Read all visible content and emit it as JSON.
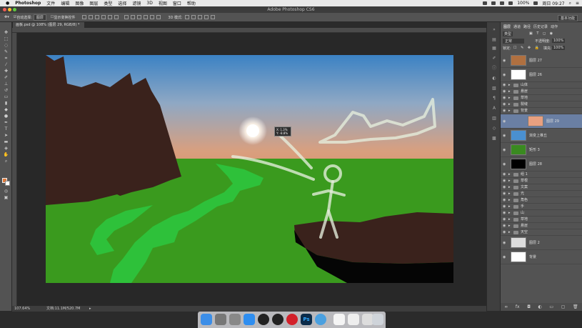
{
  "menubar": {
    "app_name": "Photoshop",
    "items": [
      "文件",
      "编辑",
      "图像",
      "图层",
      "类型",
      "选择",
      "滤镜",
      "3D",
      "视图",
      "窗口",
      "帮助"
    ],
    "battery": "100%",
    "clock": "周日 09:27"
  },
  "window": {
    "title": "Adobe Photoshop CS6"
  },
  "options": {
    "auto_select_label": "自动选择:",
    "auto_select_value": "图层",
    "show_transform_label": "显示变换控件",
    "mode_label": "3D 模式:",
    "workspace": "基本功能"
  },
  "document": {
    "tab_label": "画板.psd @ 108% (图层 29, RGB/8) *",
    "zoom": "107.64%",
    "doc_size": "文档:11.1M/520.7M"
  },
  "move_tip": {
    "x_line": "X: 1.3%",
    "y_line": "Y: -8.8%"
  },
  "layers_panel": {
    "tabs": [
      "图层",
      "通道",
      "路径",
      "历史记录",
      "动作"
    ],
    "kind_label": "类型",
    "blend_mode": "正常",
    "opacity_label": "不透明度:",
    "opacity_value": "100%",
    "lock_label": "锁定:",
    "fill_label": "填充:",
    "fill_value": "100%",
    "layers": [
      {
        "name": "图层 27",
        "type": "big",
        "thumb": "#b07040"
      },
      {
        "name": "图层 26",
        "type": "big",
        "thumb": "#ffffff"
      },
      {
        "name": "山体",
        "type": "folder"
      },
      {
        "name": "悬崖",
        "type": "folder"
      },
      {
        "name": "草地",
        "type": "folder"
      },
      {
        "name": "裂缝",
        "type": "folder"
      },
      {
        "name": "背景",
        "type": "folder"
      },
      {
        "name": "图层 29",
        "type": "big",
        "thumb": "#e8a080",
        "selected": true
      },
      {
        "name": "渐变上推丘",
        "type": "big",
        "thumb": "#4a90d0"
      },
      {
        "name": "矩形 3",
        "type": "big",
        "thumb": "#3a8a20"
      },
      {
        "name": "图层 28",
        "type": "big",
        "thumb": "#000000"
      },
      {
        "name": "组 1",
        "type": "folder"
      },
      {
        "name": "草根",
        "type": "folder"
      },
      {
        "name": "文案",
        "type": "folder"
      },
      {
        "name": "光",
        "type": "folder"
      },
      {
        "name": "角色",
        "type": "folder"
      },
      {
        "name": "手",
        "type": "folder"
      },
      {
        "name": "山",
        "type": "folder"
      },
      {
        "name": "草地",
        "type": "folder"
      },
      {
        "name": "悬崖",
        "type": "folder"
      },
      {
        "name": "天空",
        "type": "folder"
      },
      {
        "name": "图层 2",
        "type": "big",
        "thumb": "#dcdcdc"
      },
      {
        "name": "背景",
        "type": "big",
        "thumb": "#ffffff"
      }
    ]
  },
  "colors": {
    "sky_top": "#3b82c4",
    "sky_glow": "#d99f7e",
    "grass": "#3a9a1e",
    "stream": "#2ec13a",
    "mountain": "#3a221c",
    "foreground_swatch": "#e07a3a"
  },
  "dock_icons": [
    "finder-icon",
    "launchpad-icon",
    "safari-icon",
    "qq-icon",
    "qq-icon",
    "netease-music-icon",
    "photoshop-icon",
    "browser-icon",
    "preview-icon",
    "files-icon",
    "trash-icon"
  ]
}
